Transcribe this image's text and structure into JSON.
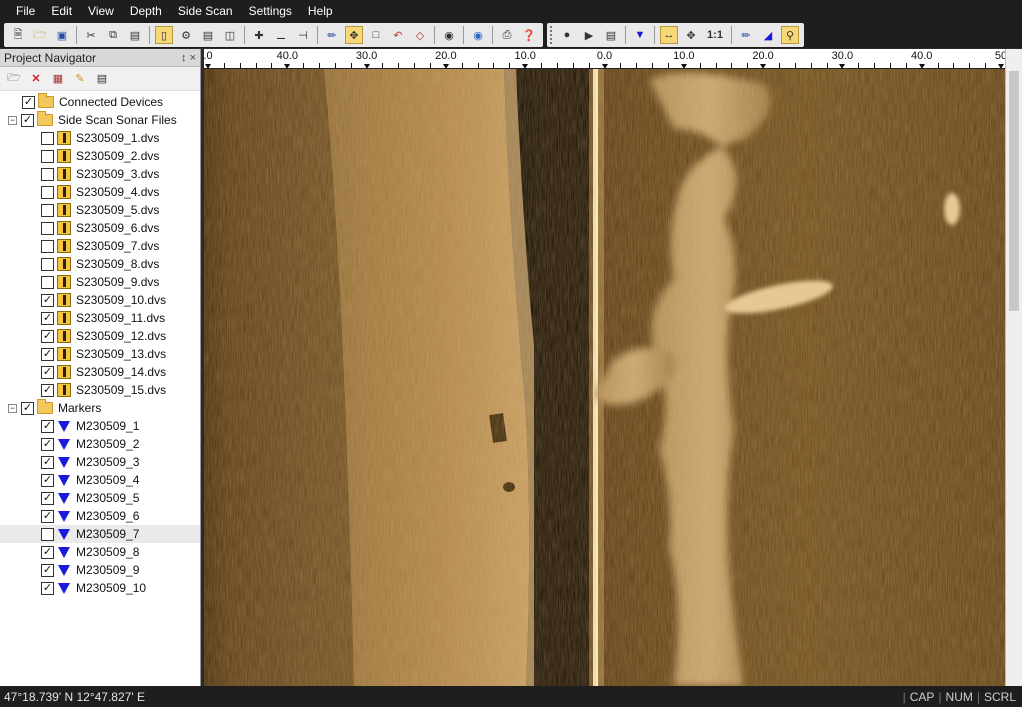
{
  "menu": [
    "File",
    "Edit",
    "View",
    "Depth",
    "Side Scan",
    "Settings",
    "Help"
  ],
  "toolbar": {
    "group1": [
      "new-file-icon",
      "open-folder-icon",
      "save-icon",
      "|",
      "cut-icon",
      "copy-icon",
      "paste-icon",
      "|",
      "sidescan-view-icon",
      "settings-view-icon",
      "film-icon",
      "split-view-icon",
      "|",
      "zoom-in-icon",
      "zoom-out-icon",
      "measure-icon",
      "|",
      "ruler-icon",
      "pan-icon",
      "select-rect-icon",
      "undo-icon",
      "erase-icon",
      "|",
      "record-marker-icon",
      "|",
      "globe-icon",
      "|",
      "print-icon",
      "help-icon"
    ],
    "group2": [
      "record-icon",
      "play-icon",
      "export-icon",
      "|",
      "marker-icon",
      "|",
      "fit-width-icon",
      "fit-all-icon",
      "one-to-one-icon",
      "|",
      "distance-icon",
      "depth-chart-icon",
      "search-icon"
    ],
    "one_to_one_label": "1:1"
  },
  "navigator": {
    "title": "Project Navigator",
    "pin_icons": "↕ ×",
    "tools": [
      "folder-open-icon",
      "delete-icon",
      "grid-icon",
      "properties-icon",
      "document-icon"
    ]
  },
  "tree": {
    "connected_devices": {
      "label": "Connected Devices",
      "checked": true
    },
    "sonar_files": {
      "label": "Side Scan Sonar Files",
      "checked": true,
      "items": [
        {
          "label": "S230509_1.dvs",
          "checked": false
        },
        {
          "label": "S230509_2.dvs",
          "checked": false
        },
        {
          "label": "S230509_3.dvs",
          "checked": false
        },
        {
          "label": "S230509_4.dvs",
          "checked": false
        },
        {
          "label": "S230509_5.dvs",
          "checked": false
        },
        {
          "label": "S230509_6.dvs",
          "checked": false
        },
        {
          "label": "S230509_7.dvs",
          "checked": false
        },
        {
          "label": "S230509_8.dvs",
          "checked": false
        },
        {
          "label": "S230509_9.dvs",
          "checked": false
        },
        {
          "label": "S230509_10.dvs",
          "checked": true
        },
        {
          "label": "S230509_11.dvs",
          "checked": true
        },
        {
          "label": "S230509_12.dvs",
          "checked": true
        },
        {
          "label": "S230509_13.dvs",
          "checked": true
        },
        {
          "label": "S230509_14.dvs",
          "checked": true
        },
        {
          "label": "S230509_15.dvs",
          "checked": true
        }
      ]
    },
    "markers": {
      "label": "Markers",
      "checked": true,
      "items": [
        {
          "label": "M230509_1",
          "checked": true
        },
        {
          "label": "M230509_2",
          "checked": true
        },
        {
          "label": "M230509_3",
          "checked": true
        },
        {
          "label": "M230509_4",
          "checked": true
        },
        {
          "label": "M230509_5",
          "checked": true
        },
        {
          "label": "M230509_6",
          "checked": true
        },
        {
          "label": "M230509_7",
          "checked": false,
          "selected": true
        },
        {
          "label": "M230509_8",
          "checked": true
        },
        {
          "label": "M230509_9",
          "checked": true
        },
        {
          "label": "M230509_10",
          "checked": true
        }
      ]
    }
  },
  "ruler": {
    "labels": [
      {
        "text": ".0",
        "value": -50
      },
      {
        "text": "40.0",
        "value": -40
      },
      {
        "text": "30.0",
        "value": -30
      },
      {
        "text": "20.0",
        "value": -20
      },
      {
        "text": "10.0",
        "value": -10
      },
      {
        "text": "0.0",
        "value": 0
      },
      {
        "text": "10.0",
        "value": 10
      },
      {
        "text": "20.0",
        "value": 20
      },
      {
        "text": "30.0",
        "value": 30
      },
      {
        "text": "40.0",
        "value": 40
      },
      {
        "text": "50",
        "value": 50
      }
    ],
    "range": [
      -50,
      50
    ]
  },
  "status": {
    "coords": "47°18.739' N  12°47.827' E",
    "cap": "CAP",
    "num": "NUM",
    "scrl": "SCRL"
  },
  "colors": {
    "sonar_dark": "#140c03",
    "sonar_bright": "#d9b27a",
    "marker_blue": "#1a1adc"
  }
}
